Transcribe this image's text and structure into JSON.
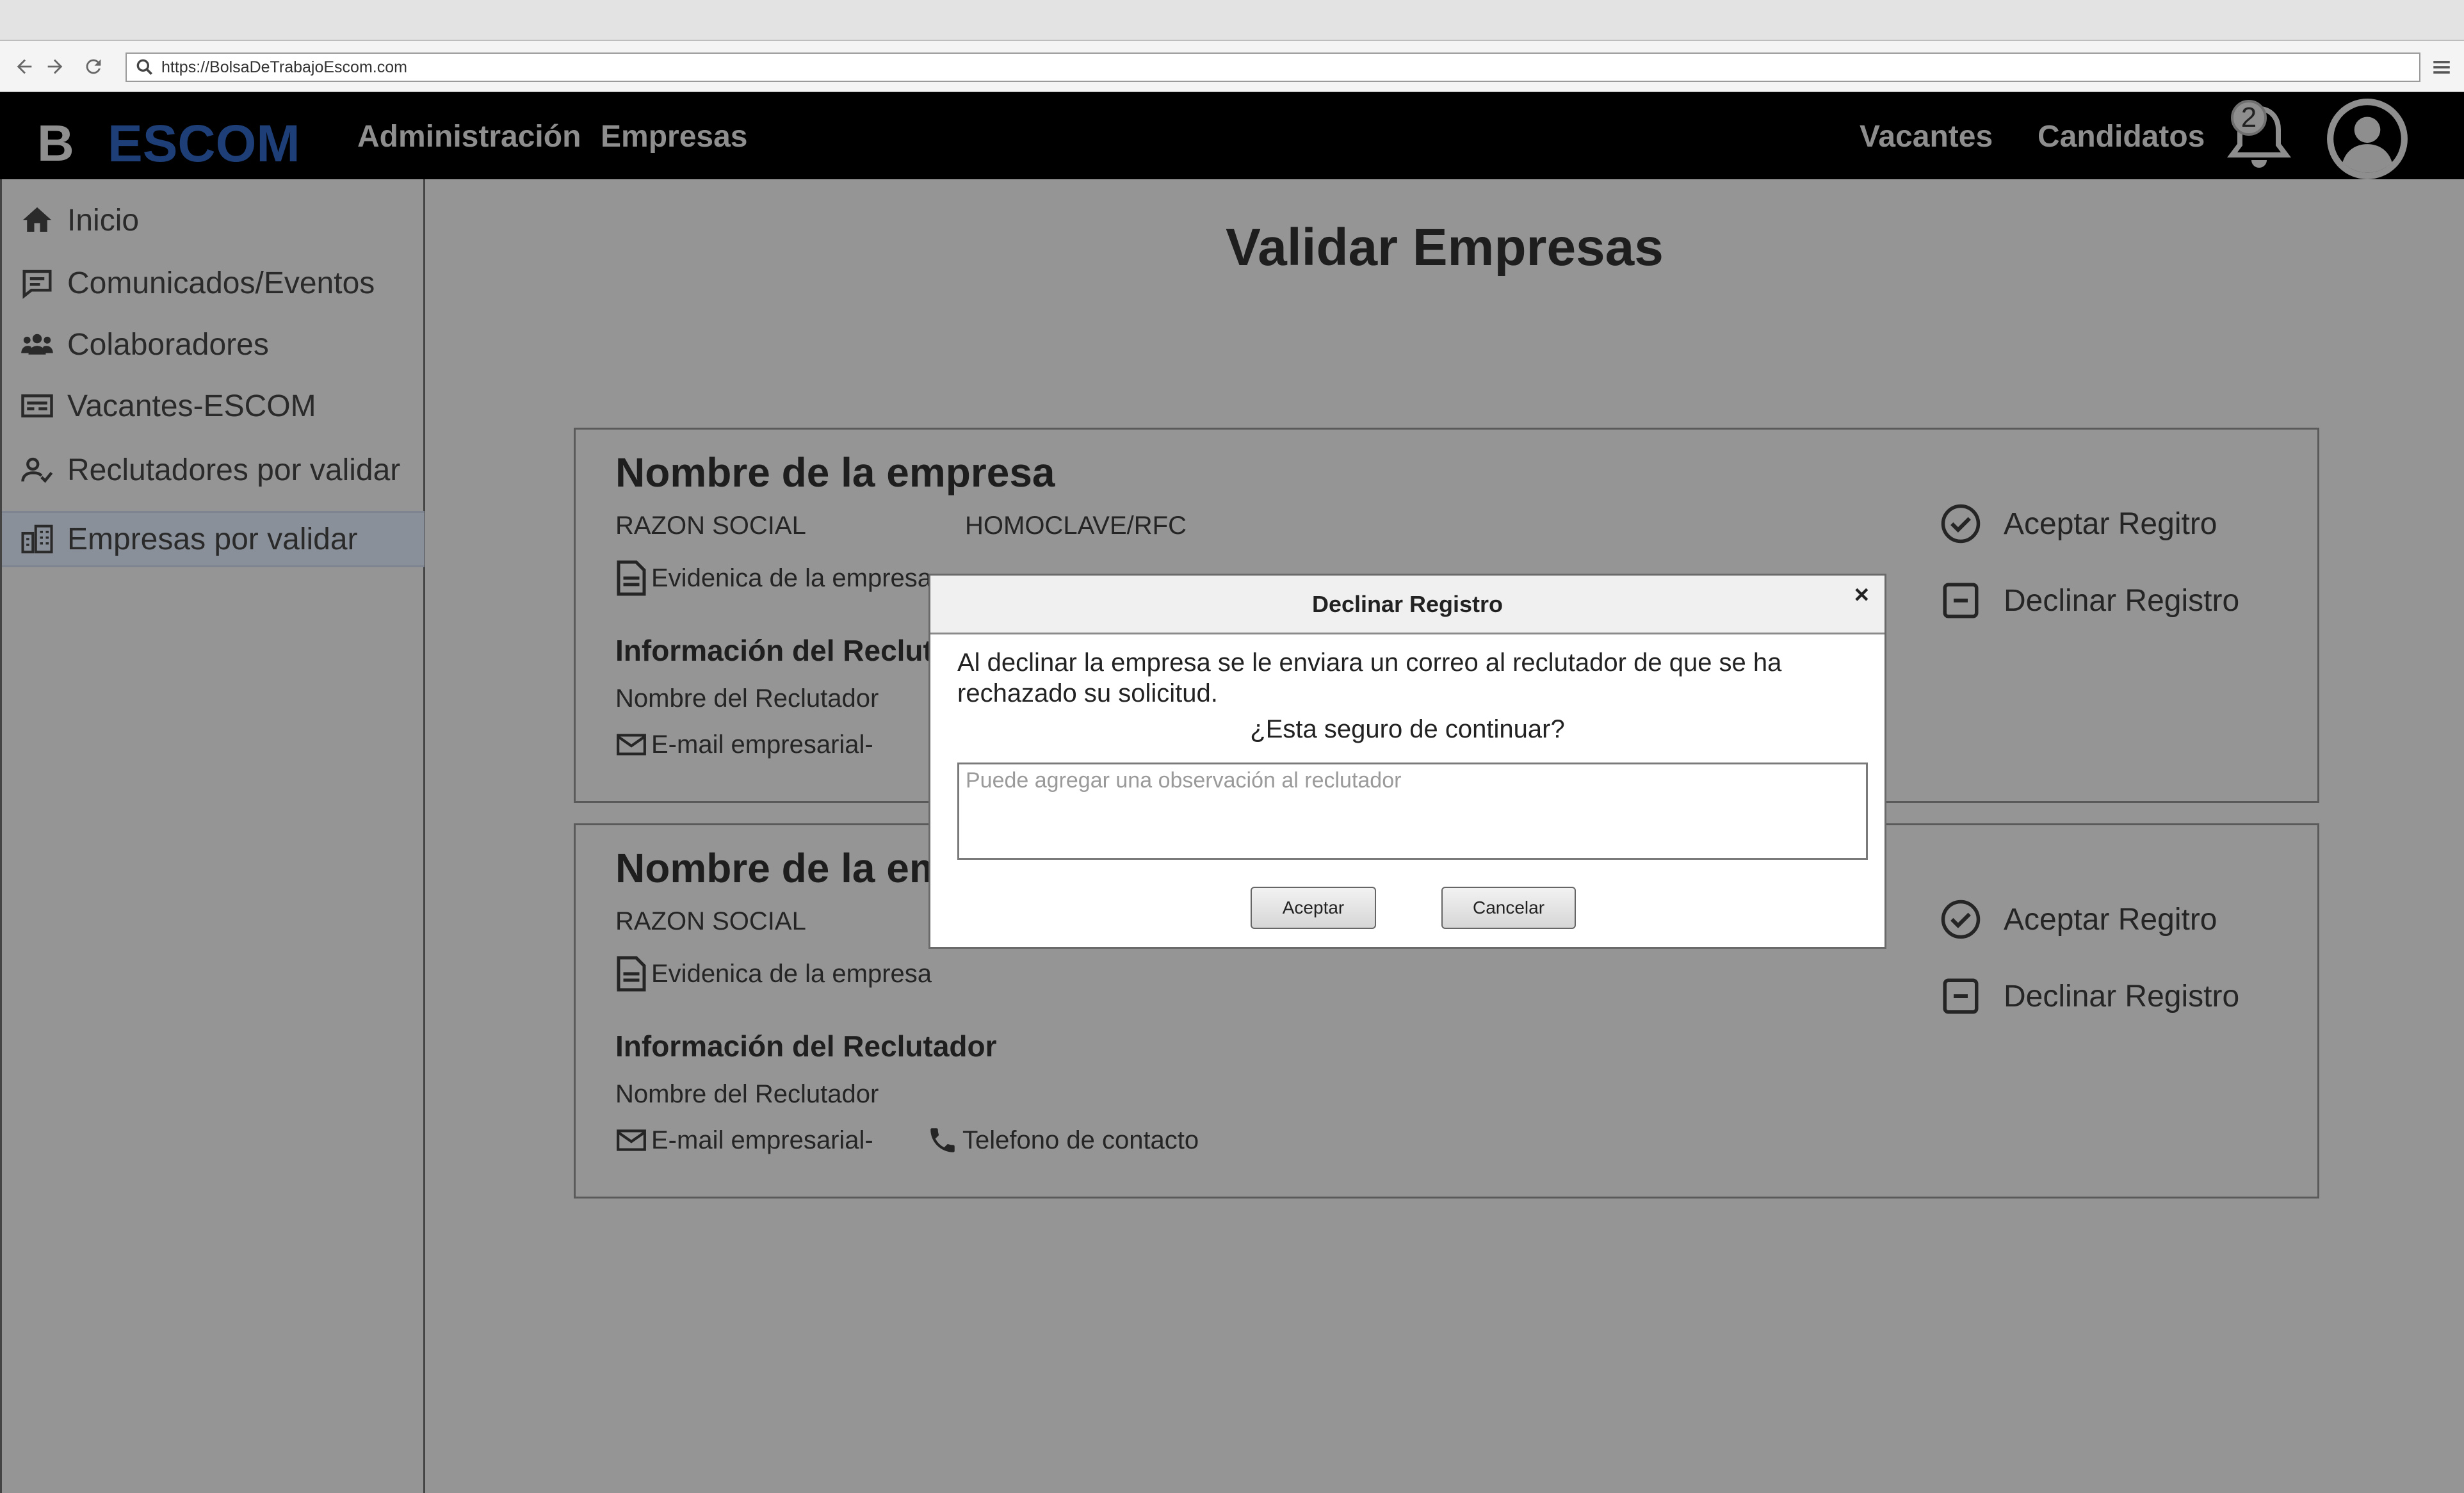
{
  "browser": {
    "url": "https://BolsaDeTrabajoEscom.com"
  },
  "header": {
    "logo_letter": "B",
    "logo_text": "ESCOM",
    "nav_left": [
      "Administración",
      "Empresas"
    ],
    "nav_right": [
      "Vacantes",
      "Candidatos"
    ],
    "notification_count": "2"
  },
  "sidebar": {
    "items": [
      {
        "label": "Inicio",
        "icon": "home-icon"
      },
      {
        "label": "Comunicados/Eventos",
        "icon": "message-icon"
      },
      {
        "label": "Colaboradores",
        "icon": "users-icon"
      },
      {
        "label": "Vacantes-ESCOM",
        "icon": "vacancy-icon"
      },
      {
        "label": "Reclutadores por validar",
        "icon": "user-check-icon"
      },
      {
        "label": "Empresas por validar",
        "icon": "building-icon"
      }
    ],
    "active_index": 5
  },
  "main": {
    "title": "Validar Empresas",
    "cards": [
      {
        "company_name": "Nombre de la empresa",
        "razon_social": "RAZON SOCIAL",
        "homoclave": "HOMOCLAVE/RFC",
        "evidence": "Evidenica de la empresa",
        "recruiter_heading": "Información del Reclutador",
        "recruiter_name": "Nombre del Reclutador",
        "email": "E-mail empresarial-",
        "phone": "",
        "accept_label": "Aceptar Regitro",
        "decline_label": "Declinar Registro"
      },
      {
        "company_name": "Nombre de la em",
        "razon_social": "RAZON SOCIAL",
        "homoclave": "",
        "evidence": "Evidenica de la empresa",
        "recruiter_heading": "Información del Reclutador",
        "recruiter_name": "Nombre del Reclutador",
        "email": "E-mail empresarial-",
        "phone": "Telefono de contacto",
        "accept_label": "Aceptar Regitro",
        "decline_label": "Declinar Registro"
      }
    ]
  },
  "dialog": {
    "title": "Declinar Registro",
    "close": "×",
    "message": "Al declinar la empresa se le enviara un correo al reclutador de que se ha  rechazado su solicitud.",
    "question": "¿Esta seguro de continuar?",
    "input_placeholder": "Puede agregar una observación al reclutador",
    "accept_label": "Aceptar",
    "cancel_label": "Cancelar"
  }
}
